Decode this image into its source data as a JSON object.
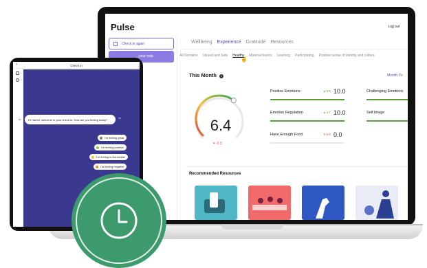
{
  "laptop": {
    "brand": "Pulse",
    "logout": "Log out",
    "sidebar": {
      "checkin_label": "Check in again",
      "help_label": "...your help"
    },
    "tabs": [
      {
        "label": "Wellbeing",
        "active": false
      },
      {
        "label": "Experience",
        "active": true
      },
      {
        "label": "Gratitude",
        "active": false
      },
      {
        "label": "Resources",
        "active": false
      }
    ],
    "subtabs": [
      {
        "label": "All Domains",
        "active": false
      },
      {
        "label": "Valued and Safe",
        "active": false
      },
      {
        "label": "Healthy",
        "active": true
      },
      {
        "label": "Material basics",
        "active": false
      },
      {
        "label": "Learning",
        "active": false
      },
      {
        "label": "Participating",
        "active": false
      },
      {
        "label": "Positive sense of identity and culture",
        "active": false
      }
    ],
    "this_month": {
      "title": "This Month",
      "month_link": "Month To",
      "score": "6.4",
      "score_change": "-0.3",
      "gauge_level": 0.64
    },
    "metrics": [
      {
        "name": "Positive Emotions",
        "change": "3.6",
        "value": "10.0",
        "direction": "up"
      },
      {
        "name": "Emotion Regulation",
        "change": "4.7",
        "value": "10.0",
        "direction": "up"
      },
      {
        "name": "Have Enough Food",
        "change": "5.0",
        "value": "0.0",
        "direction": "down"
      },
      {
        "name": "Challenging Emotions",
        "change": "",
        "value": "",
        "direction": ""
      },
      {
        "name": "Self Image",
        "change": "",
        "value": "",
        "direction": ""
      }
    ],
    "recommended": {
      "title": "Recommended Resources"
    }
  },
  "tablet": {
    "header": "Check in",
    "bot_message": "Hi Harriet, welcome to your check-in. How are you feeling today?",
    "bot_time": "4h",
    "options": [
      {
        "label": "I'm feeling great",
        "color": "#5a9d3a"
      },
      {
        "label": "I'm feeling positive",
        "color": "#9ccc3d"
      },
      {
        "label": "I'm feeling in the middle",
        "color": "#f0c330"
      },
      {
        "label": "I'm feeling negative",
        "color": "#f08a2c"
      }
    ]
  },
  "colors": {
    "accent": "#5b4bc0",
    "badge": "#3d9a6d",
    "chat_bg": "#3b388f"
  },
  "badge_icon": "clock-icon"
}
